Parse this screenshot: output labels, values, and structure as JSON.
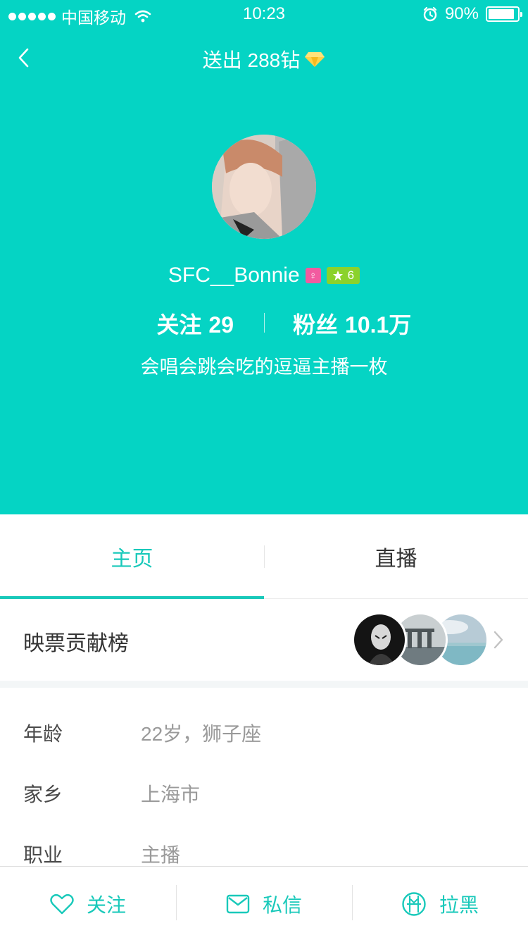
{
  "status_bar": {
    "carrier": "中国移动",
    "time": "10:23",
    "battery_percent": "90%",
    "battery_level": 0.9,
    "signal_icon": "signal-dots-icon",
    "wifi_icon": "wifi-icon",
    "alarm_icon": "alarm-icon"
  },
  "nav": {
    "title": "送出 288钻",
    "back_icon": "chevron-left-icon",
    "title_icon": "diamond-icon"
  },
  "profile": {
    "username": "SFC__Bonnie",
    "gender_icon": "female-icon",
    "level": "6",
    "level_icon": "star-icon",
    "follow_label": "关注",
    "follow_count": "29",
    "fans_label": "粉丝",
    "fans_count": "10.1万",
    "bio": "会唱会跳会吃的逗逼主播一枚"
  },
  "tabs": [
    {
      "label": "主页",
      "active": true
    },
    {
      "label": "直播",
      "active": false
    }
  ],
  "contribution": {
    "label": "映票贡献榜",
    "avatar_count": 3,
    "chevron_icon": "chevron-right-icon"
  },
  "info": {
    "age": {
      "label": "年龄",
      "value": "22岁，狮子座"
    },
    "hometown": {
      "label": "家乡",
      "value": "上海市"
    },
    "job": {
      "label": "职业",
      "value": "主播"
    }
  },
  "bottom_bar": {
    "follow_label": "关注",
    "message_label": "私信",
    "block_label": "拉黑",
    "follow_icon": "heart-icon",
    "message_icon": "envelope-icon",
    "block_icon": "block-icon"
  },
  "colors": {
    "header_bg": "#05d4c4",
    "accent": "#19c9ba",
    "gender_badge": "#f25ba0",
    "level_badge": "#8bd22c"
  }
}
